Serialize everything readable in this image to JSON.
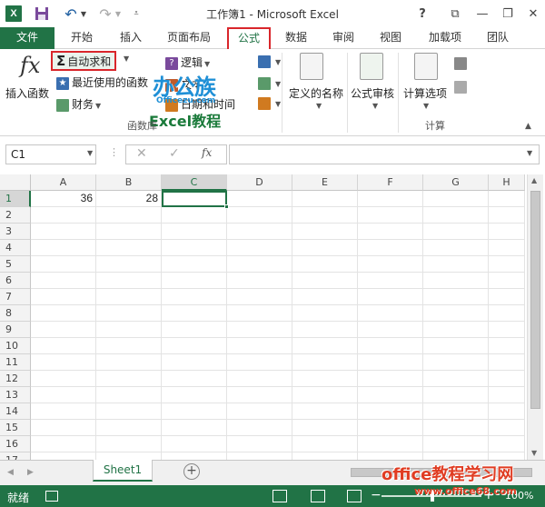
{
  "titlebar": {
    "app_icon_label": "X",
    "title": "工作簿1 - Microsoft Excel",
    "help": "?",
    "minimize": "—",
    "restore": "❐",
    "close": "✕",
    "ribbon_display": "⧉"
  },
  "tabs": {
    "file": "文件",
    "home": "开始",
    "insert": "插入",
    "page_layout": "页面布局",
    "formulas": "公式",
    "data": "数据",
    "review": "审阅",
    "view": "视图",
    "addins": "加载项",
    "team": "团队"
  },
  "ribbon": {
    "insert_function": "插入函数",
    "autosum": "自动求和",
    "recently_used": "最近使用的函数",
    "financial": "财务",
    "logical": "逻辑",
    "text": "文本",
    "date_time": "日期和时间",
    "function_library_group": "函数库",
    "defined_names": "定义的名称",
    "formula_auditing": "公式审核",
    "calculation_options": "计算选项",
    "calculation_group": "计算"
  },
  "watermark": {
    "logo": "办公族",
    "url": "Officezu.com",
    "excel_tutorial": "Excel教程"
  },
  "formula_bar": {
    "name_box": "C1",
    "formula": "",
    "fx": "fx",
    "cancel": "✕",
    "enter": "✓"
  },
  "grid": {
    "columns": [
      "A",
      "B",
      "C",
      "D",
      "E",
      "F",
      "G",
      "H"
    ],
    "rows": [
      "1",
      "2",
      "3",
      "4",
      "5",
      "6",
      "7",
      "8",
      "9",
      "10",
      "11",
      "12",
      "13",
      "14",
      "15",
      "16",
      "17"
    ],
    "cells": {
      "A1": "36",
      "B1": "28"
    },
    "active_cell": "C1"
  },
  "sheets": {
    "tab": "Sheet1",
    "add": "+"
  },
  "status": {
    "ready": "就绪",
    "zoom": "100%"
  },
  "site": {
    "title": "office教程学习网",
    "url": "www.office68.com"
  },
  "colors": {
    "excel_green": "#217346",
    "highlight_red": "#d9262b"
  }
}
